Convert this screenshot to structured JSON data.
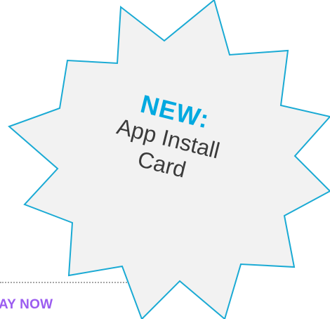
{
  "card": {
    "cta_label": "AY NOW"
  },
  "badge": {
    "title": "NEW:",
    "line1": "App Install",
    "line2": "Card",
    "accent_color": "#00a9e0",
    "fill_color": "#f2f2f2"
  }
}
